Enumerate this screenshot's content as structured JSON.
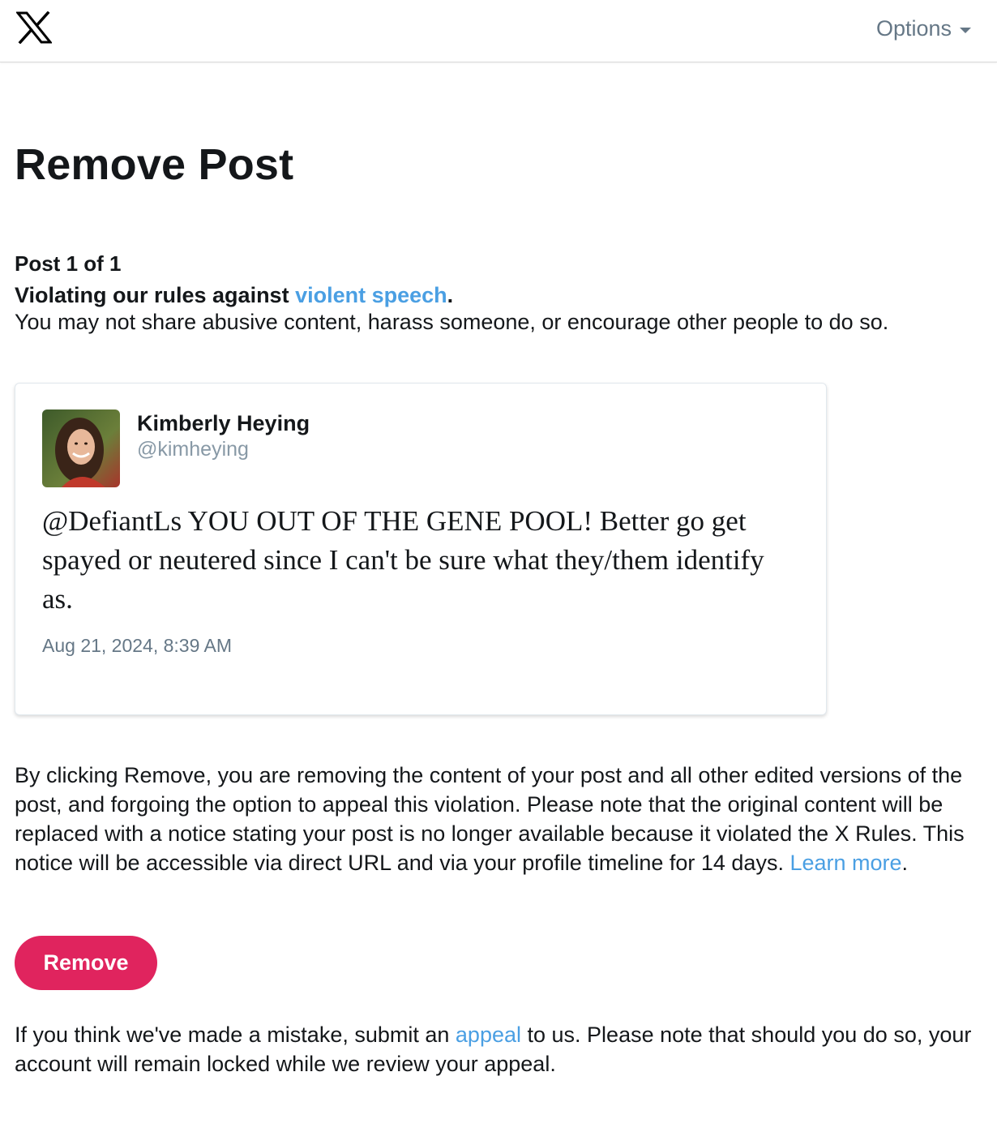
{
  "header": {
    "options_label": "Options"
  },
  "page": {
    "title": "Remove Post",
    "post_count": "Post 1 of 1",
    "violation_prefix": "Violating our rules against ",
    "violation_link": "violent speech",
    "violation_suffix": ".",
    "violation_description": "You may not share abusive content, harass someone, or encourage other people to do so."
  },
  "post": {
    "author_name": "Kimberly Heying",
    "author_handle": "@kimheying",
    "text": "@DefiantLs YOU OUT OF THE GENE POOL! Better go get spayed or neutered since I can't be sure what they/them identify as.",
    "timestamp": "Aug 21, 2024, 8:39 AM"
  },
  "remove_info": {
    "text": "By clicking Remove, you are removing the content of your post and all other edited versions of the post, and forgoing the option to appeal this violation. Please note that the original content will be replaced with a notice stating your post is no longer available because it violated the X Rules. This notice will be accessible via direct URL and via your profile timeline for 14 days. ",
    "learn_more_link": "Learn more",
    "learn_more_suffix": "."
  },
  "actions": {
    "remove_label": "Remove"
  },
  "appeal_info": {
    "prefix": "If you think we've made a mistake, submit an ",
    "link": "appeal",
    "suffix": " to us. Please note that should you do so, your account will remain locked while we review your appeal."
  },
  "colors": {
    "link": "#4a9fe3",
    "remove_button": "#e0245e",
    "muted_text": "#657786"
  }
}
